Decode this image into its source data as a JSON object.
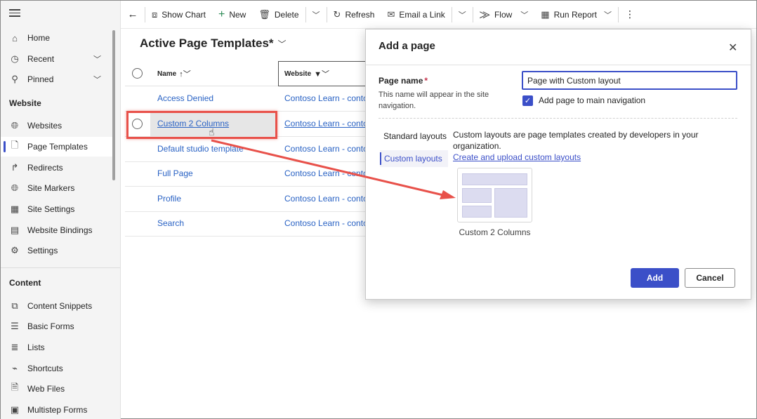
{
  "sidebar": {
    "items_top": [
      {
        "label": "Home",
        "icon": "home-icon"
      },
      {
        "label": "Recent",
        "icon": "clock-icon"
      },
      {
        "label": "Pinned",
        "icon": "pin-icon"
      }
    ],
    "section_website": "Website",
    "website_items": [
      {
        "label": "Websites",
        "icon": "globe-icon"
      },
      {
        "label": "Page Templates",
        "icon": "page-icon"
      },
      {
        "label": "Redirects",
        "icon": "redirect-icon"
      },
      {
        "label": "Site Markers",
        "icon": "globe-icon"
      },
      {
        "label": "Site Settings",
        "icon": "settings-grid-icon"
      },
      {
        "label": "Website Bindings",
        "icon": "binding-icon"
      },
      {
        "label": "Settings",
        "icon": "gear-icon"
      }
    ],
    "section_content": "Content",
    "content_items": [
      {
        "label": "Content Snippets",
        "icon": "snippet-icon"
      },
      {
        "label": "Basic Forms",
        "icon": "form-icon"
      },
      {
        "label": "Lists",
        "icon": "list-icon"
      },
      {
        "label": "Shortcuts",
        "icon": "shortcut-icon"
      },
      {
        "label": "Web Files",
        "icon": "file-icon"
      },
      {
        "label": "Multistep Forms",
        "icon": "multistep-icon"
      }
    ]
  },
  "toolbar": {
    "show_chart": "Show Chart",
    "new": "New",
    "delete": "Delete",
    "refresh": "Refresh",
    "email_link": "Email a Link",
    "flow": "Flow",
    "run_report": "Run Report"
  },
  "view": {
    "title": "Active Page Templates*",
    "col_name": "Name",
    "col_website": "Website",
    "rows": [
      {
        "name": "Access Denied",
        "website": "Contoso Learn - contoso"
      },
      {
        "name": "Custom 2 Columns",
        "website": "Contoso Learn - contoso"
      },
      {
        "name": "Default studio template",
        "website": "Contoso Learn - contoso"
      },
      {
        "name": "Full Page",
        "website": "Contoso Learn - contoso"
      },
      {
        "name": "Profile",
        "website": "Contoso Learn - contoso"
      },
      {
        "name": "Search",
        "website": "Contoso Learn - contoso"
      }
    ]
  },
  "dialog": {
    "title": "Add a page",
    "page_name_label": "Page name",
    "required_mark": "*",
    "page_name_help": "This name will appear in the site navigation.",
    "page_name_value": "Page with Custom layout",
    "add_to_nav_label": "Add page to main navigation",
    "add_to_nav_checked": true,
    "tab_standard": "Standard layouts",
    "tab_custom": "Custom layouts",
    "custom_desc": "Custom layouts are page templates created by developers in your organization.",
    "custom_link": "Create and upload custom layouts",
    "layout_name": "Custom 2 Columns",
    "add_button": "Add",
    "cancel_button": "Cancel"
  },
  "colors": {
    "accent": "#3b4fc8",
    "link": "#2962c4",
    "annotation_red": "#e8514a"
  }
}
